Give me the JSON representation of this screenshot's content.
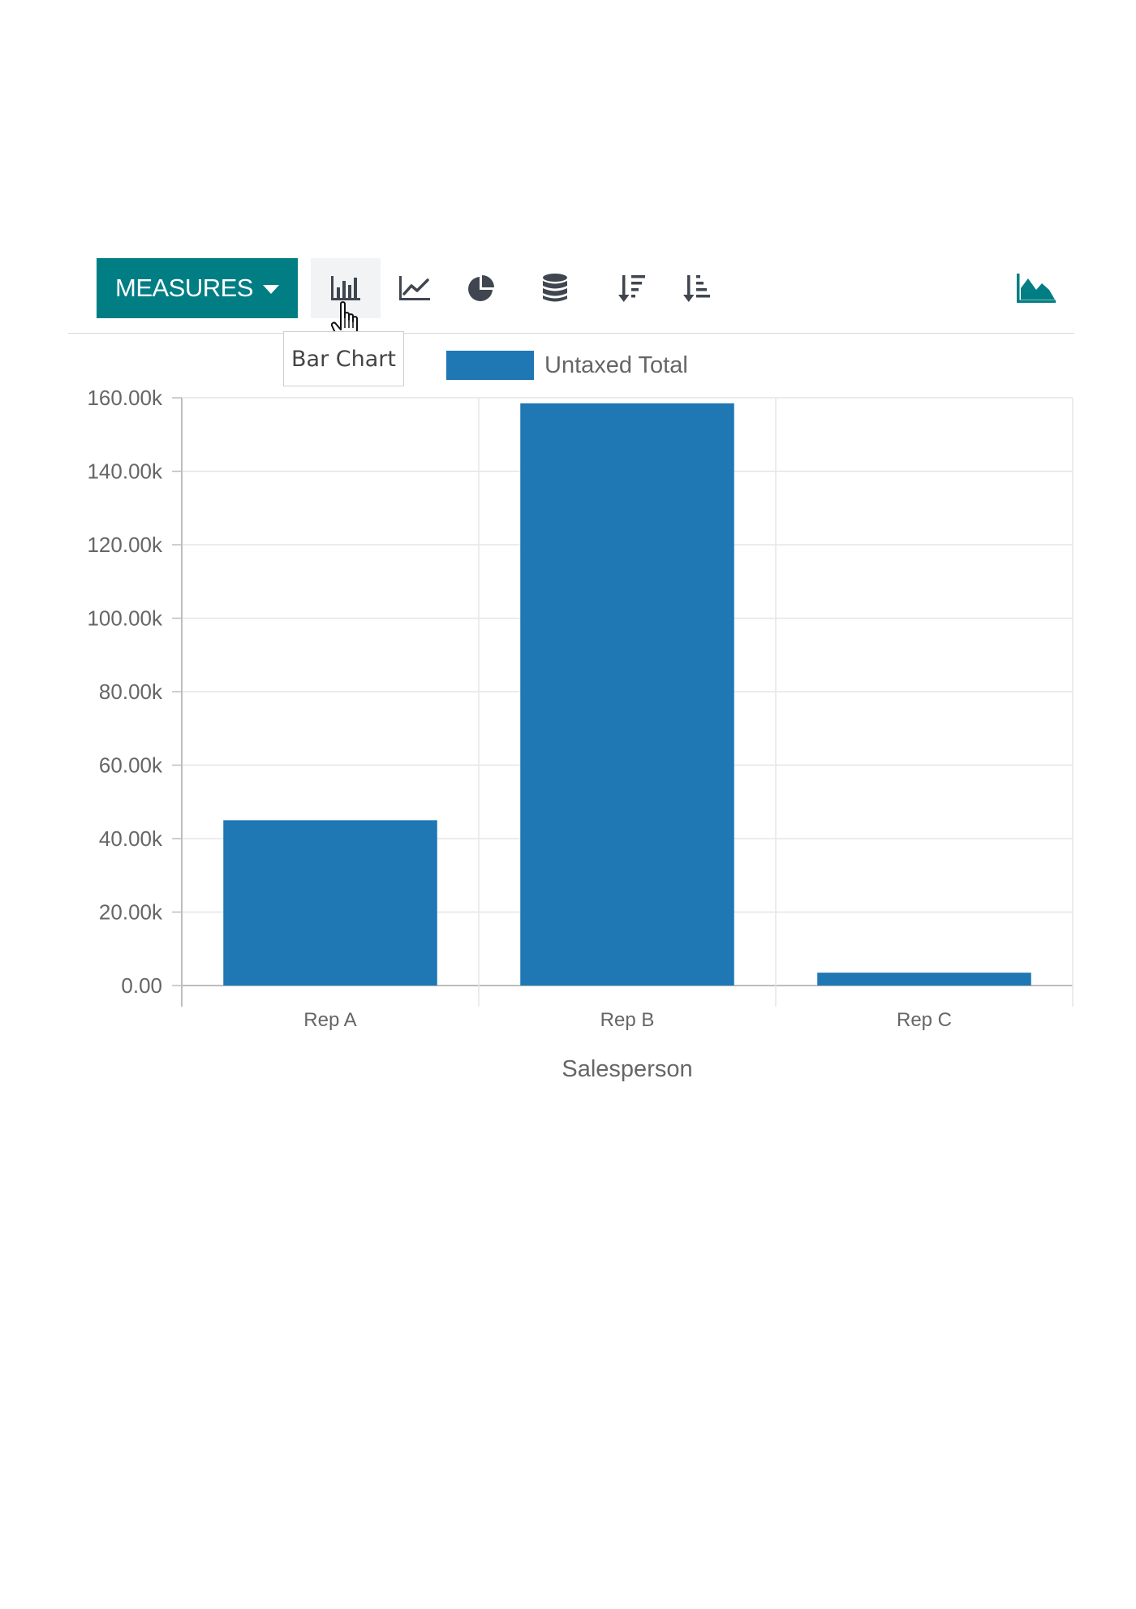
{
  "toolbar": {
    "measures_label": "MEASURES",
    "tooltip": "Bar Chart",
    "tools": [
      {
        "name": "bar-chart-icon",
        "active": true
      },
      {
        "name": "line-chart-icon",
        "active": false
      },
      {
        "name": "pie-chart-icon",
        "active": false
      },
      {
        "name": "stacked-icon",
        "active": false
      },
      {
        "name": "sort-descending-icon",
        "active": false
      },
      {
        "name": "sort-ascending-icon",
        "active": false
      },
      {
        "name": "cumulative-area-icon",
        "active": false
      }
    ]
  },
  "colors": {
    "accent": "#017e84",
    "bar": "#1f77b4",
    "icon": "#3f4650"
  },
  "chart_data": {
    "type": "bar",
    "categories": [
      "Rep A",
      "Rep B",
      "Rep C"
    ],
    "series": [
      {
        "name": "Untaxed Total",
        "values": [
          45000,
          158500,
          3500
        ]
      }
    ],
    "xlabel": "Salesperson",
    "ylabel": "",
    "ylim": [
      0,
      160000
    ],
    "yticks": [
      "0.00",
      "20.00k",
      "40.00k",
      "60.00k",
      "80.00k",
      "100.00k",
      "120.00k",
      "140.00k",
      "160.00k"
    ],
    "grid": true,
    "legend": "top"
  }
}
